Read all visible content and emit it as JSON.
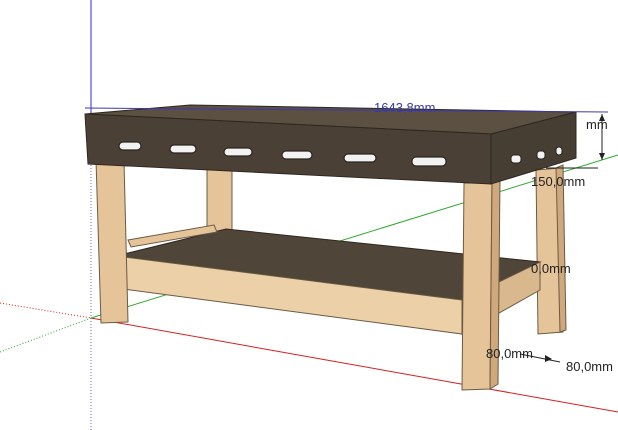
{
  "viewport": {
    "background": "#ffffff",
    "axes": {
      "red": "#d42020",
      "green": "#2ea82e",
      "blue": "#2828d8"
    },
    "model": {
      "name": "workbench",
      "top_color": "#5b5042",
      "top_dark": "#4a4036",
      "leg_color": "#e6c49a",
      "leg_shade": "#cfa97c",
      "shelf_color": "#4f4538"
    },
    "dimensions": {
      "length_label": "1643,8mm",
      "top_thickness_label": "mm",
      "front_height_label": "150,0mm",
      "shelf_label": "0,0mm",
      "leg_depth_label": "80,0mm",
      "leg_width_label": "80,0mm"
    }
  }
}
